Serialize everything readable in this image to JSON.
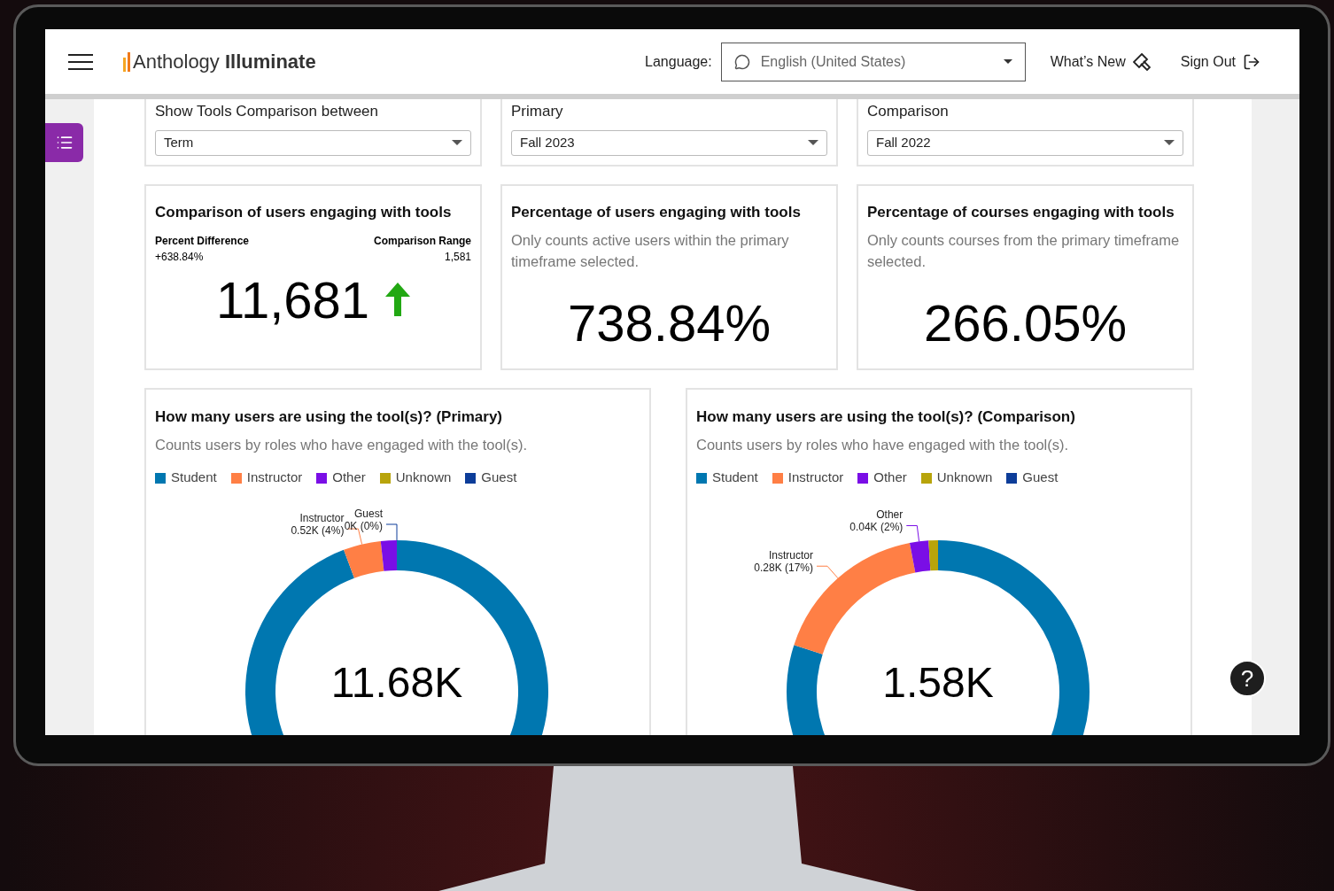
{
  "header": {
    "logo": "Anthology **Illuminate**",
    "language_label": "Language:",
    "language_value": "English (United States)",
    "whats_new": "What’s New",
    "sign_out": "Sign Out"
  },
  "filters": [
    {
      "label": "Show Tools Comparison between",
      "value": "Term"
    },
    {
      "label": "Primary",
      "value": "Fall 2023"
    },
    {
      "label": "Comparison",
      "value": "Fall 2022"
    }
  ],
  "comparison_card": {
    "title": "Comparison of users engaging with tools",
    "left_label": "Percent Difference",
    "left_value": "+638.84%",
    "right_label": "Comparison Range",
    "right_value": "1,581",
    "value": "11,681"
  },
  "stat_cards": [
    {
      "title": "Percentage of users engaging with tools",
      "subtitle": "Only counts active users within the primary timeframe selected.",
      "value": "738.84%"
    },
    {
      "title": "Percentage of courses engaging with tools",
      "subtitle": "Only counts courses from the primary timeframe selected.",
      "value": "266.05%"
    }
  ],
  "chart_cards": [
    {
      "title": "How many users are using the tool(s)? (Primary)",
      "subtitle": "Counts users by roles who have engaged with the tool(s).",
      "center_value": "11.68K",
      "chart_data": {
        "type": "donut",
        "categories": [
          "Student",
          "Instructor",
          "Other",
          "Unknown",
          "Guest"
        ],
        "series": [
          {
            "colors": [
              "#0077b0",
              "#ff7f45",
              "#7a0ee6",
              "#b8a40b",
              "#0d3d99"
            ],
            "values": [
              94.3,
              4,
              1.7,
              0,
              0
            ]
          }
        ],
        "value_labels": [
          null,
          "Instructor\n0.52K (4%)",
          null,
          null,
          "Guest\n0K (0%)"
        ]
      }
    },
    {
      "title": "How many users are using the tool(s)? (Comparison)",
      "subtitle": "Counts users by roles who have engaged with the tool(s).",
      "center_value": "1.58K",
      "chart_data": {
        "type": "donut",
        "categories": [
          "Student",
          "Instructor",
          "Other",
          "Unknown",
          "Guest"
        ],
        "series": [
          {
            "colors": [
              "#0077b0",
              "#ff7f45",
              "#7a0ee6",
              "#b8a40b",
              "#0d3d99"
            ],
            "values": [
              80,
              17,
              2,
              1,
              0
            ]
          }
        ],
        "value_labels": [
          null,
          "Instructor\n0.28K (17%)",
          "Other\n0.04K (2%)",
          null,
          null
        ]
      }
    }
  ],
  "help_button": "?"
}
